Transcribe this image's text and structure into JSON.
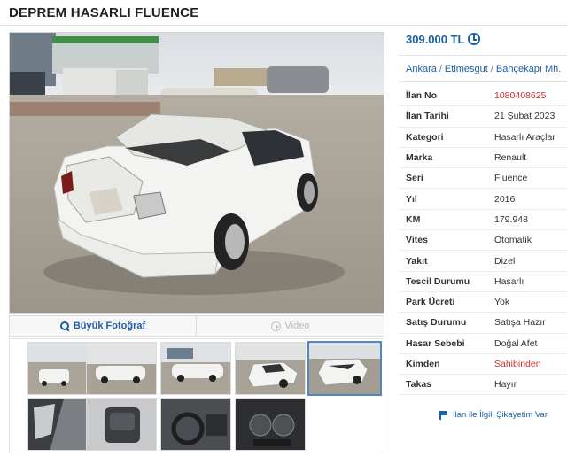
{
  "listing": {
    "title": "DEPREM HASARLI FLUENCE",
    "price": "309.000 TL",
    "location": {
      "city": "Ankara",
      "district": "Etimesgut",
      "neighborhood": "Bahçekapı Mh."
    },
    "attributes": [
      {
        "key": "İlan No",
        "value": "1080408625",
        "highlight": true
      },
      {
        "key": "İlan Tarihi",
        "value": "21 Şubat 2023"
      },
      {
        "key": "Kategori",
        "value": "Hasarlı Araçlar"
      },
      {
        "key": "Marka",
        "value": "Renault"
      },
      {
        "key": "Seri",
        "value": "Fluence"
      },
      {
        "key": "Yıl",
        "value": "2016"
      },
      {
        "key": "KM",
        "value": "179.948"
      },
      {
        "key": "Vites",
        "value": "Otomatik"
      },
      {
        "key": "Yakıt",
        "value": "Dizel"
      },
      {
        "key": "Tescil Durumu",
        "value": "Hasarlı"
      },
      {
        "key": "Park Ücreti",
        "value": "Yok"
      },
      {
        "key": "Satış Durumu",
        "value": "Satışa Hazır"
      },
      {
        "key": "Hasar Sebebi",
        "value": "Doğal Afet"
      },
      {
        "key": "Kimden",
        "value": "Sahibinden",
        "highlight": true
      },
      {
        "key": "Takas",
        "value": "Hayır"
      }
    ],
    "report_label": "İlan ile İlgili Şikayetim Var"
  },
  "photo_bar": {
    "big_photo_label": "Büyük Fotoğraf",
    "video_label": "Video"
  },
  "thumbnails": {
    "count": 9,
    "active_index": 4
  },
  "icons": {
    "price_history": "history-icon",
    "big_photo": "magnifier-icon",
    "video": "play-icon",
    "report": "flag-icon"
  },
  "colors": {
    "link": "#1b5fa6",
    "highlight": "#c9302c",
    "car": "#f2f2f0"
  }
}
